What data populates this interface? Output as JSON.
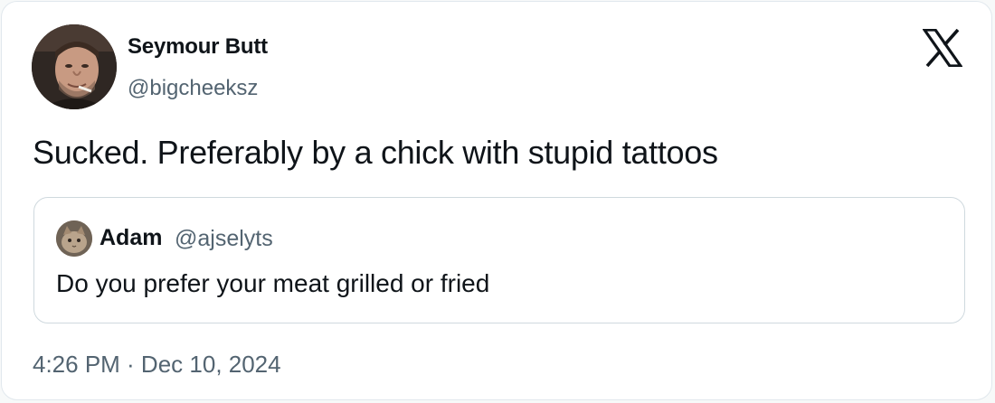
{
  "tweet": {
    "author_name": "Seymour Butt",
    "author_handle": "@bigcheeksz",
    "text": "Sucked. Preferably by a chick with stupid tattoos",
    "timestamp": "4:26 PM · Dec 10, 2024",
    "brand_icon": "x-logo-icon"
  },
  "quoted_tweet": {
    "author_name": "Adam",
    "author_handle": "@ajselyts",
    "text": "Do you prefer your meat grilled or fried"
  },
  "colors": {
    "text_primary": "#0f1419",
    "text_secondary": "#536471",
    "border": "#cfd9de",
    "background": "#ffffff"
  }
}
